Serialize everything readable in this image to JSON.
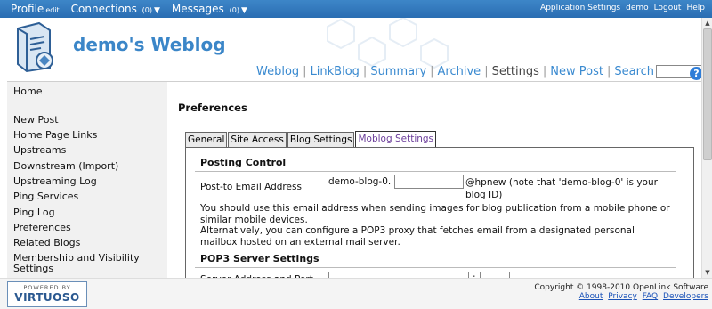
{
  "topbar": {
    "profile": "Profile",
    "profile_edit": "edit",
    "connections": "Connections",
    "connections_count": "(0)",
    "messages": "Messages",
    "messages_count": "(0)",
    "caret": "▼",
    "right_links": [
      "Application Settings",
      "demo",
      "Logout",
      "Help"
    ]
  },
  "header": {
    "title": "demo's Weblog",
    "nav": [
      "Weblog",
      "LinkBlog",
      "Summary",
      "Archive",
      "Settings",
      "New Post",
      "Search"
    ],
    "nav_separator": "|",
    "current": "Settings",
    "search_value": "",
    "search_go": "?"
  },
  "sidebar": {
    "items": [
      "Home",
      "New Post",
      "Home Page Links",
      "Upstreams",
      "Downstream (Import)",
      "Upstreaming Log",
      "Ping Services",
      "Ping Log",
      "Preferences",
      "Related Blogs",
      "Membership and Visibility",
      "Settings"
    ]
  },
  "main": {
    "title": "Preferences",
    "tabs": [
      "General",
      "Site Access",
      "Blog Settings",
      "Moblog Settings"
    ],
    "active_tab": "Moblog Settings",
    "posting_control": {
      "title": "Posting Control",
      "email_label": "Post-to Email Address",
      "email_prefix": "demo-blog-0.",
      "email_value": "",
      "email_suffix": "@hpnew (note that 'demo-blog-0' is your blog ID)",
      "para1": "You should use this email address when sending images for blog publication from a mobile phone or similar mobile devices.",
      "para2": "Alternatively, you can configure a POP3 proxy that fetches email from a designated personal mailbox hosted on an external mail server."
    },
    "pop3": {
      "title": "POP3 Server Settings",
      "server_label": "Server Address and Port",
      "server_value": "",
      "colon": ":",
      "port_value": ""
    }
  },
  "footer": {
    "powered_by": "POWERED BY",
    "brand": "VIRTUOSO",
    "copyright": "Copyright © 1998-2010 OpenLink Software",
    "links": [
      "About",
      "Privacy",
      "FAQ",
      "Developers"
    ]
  },
  "colors": {
    "topbar": "#2f74b8",
    "title_blue": "#3b86c8",
    "link_blue": "#3a8ad0",
    "active_tab_text": "#6b3d9a",
    "sidebar_bg": "#f1f1f1"
  }
}
